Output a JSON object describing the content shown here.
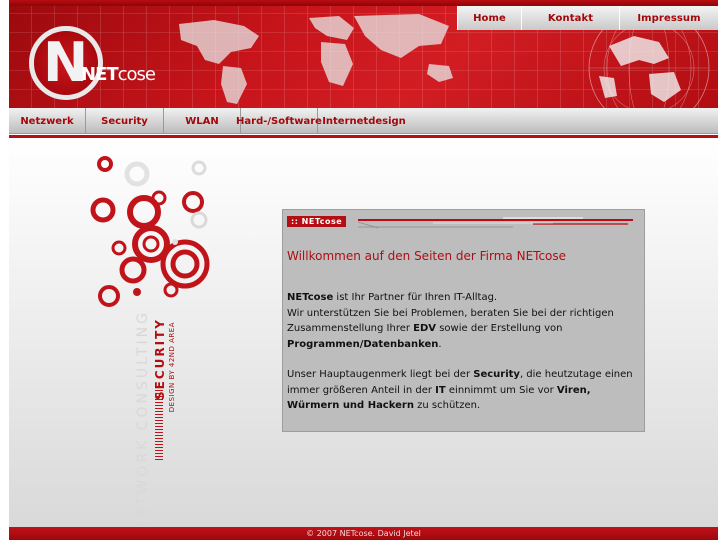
{
  "topnav": {
    "items": [
      {
        "label": "Home"
      },
      {
        "label": "Kontakt"
      },
      {
        "label": "Impressum"
      }
    ]
  },
  "logo": {
    "letter": "N",
    "word_bold": "NET",
    "word_light": "cose"
  },
  "mainnav": {
    "items": [
      {
        "label": "Netzwerk"
      },
      {
        "label": "Security"
      },
      {
        "label": "WLAN"
      },
      {
        "label": "Hard-/Software"
      },
      {
        "label": "Internetdesign"
      }
    ]
  },
  "side_art": {
    "line1": "NETWORK CONSULTING",
    "line2": "SECURITY",
    "line3": "DESIGN BY 42ND AREA"
  },
  "content": {
    "tag": ":: NETcose",
    "title": "Willkommen auf den Seiten der Firma NETcose",
    "p1": {
      "company": "NETcose",
      "t1": " ist Ihr Partner für Ihren IT-Alltag.",
      "t2": "Wir unterstützen Sie bei Problemen, beraten Sie bei der richtigen Zusammenstellung Ihrer ",
      "edv": "EDV",
      "t3": " sowie der Erstellung von ",
      "prog": "Programmen/Datenbanken",
      "t4": "."
    },
    "p2": {
      "t1": "Unser Hauptaugenmerk liegt bei der ",
      "security": "Security",
      "t2": ", die heutzutage einen immer größeren Anteil in der ",
      "it": "IT",
      "t3": " einnimmt um Sie vor ",
      "viren": "Viren, Würmern und Hackern",
      "t4": " zu schützen."
    }
  },
  "footer": {
    "text": "© 2007 NETcose. David Jetel"
  },
  "colors": {
    "brand_red": "#b80d12",
    "nav_gray": "#d0d0d0"
  }
}
